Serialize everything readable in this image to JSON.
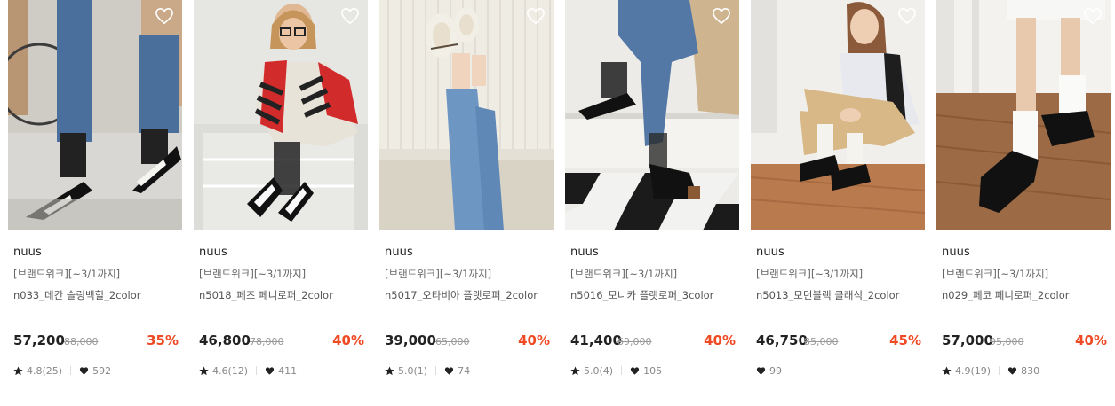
{
  "products": [
    {
      "brand": "nuus",
      "promo": "[브랜드위크][~3/1까지]",
      "name": "n033_데칸 슬링백힐_2color",
      "price": "57,200",
      "original_price": "88,000",
      "discount": "35%",
      "rating": "4.8(25)",
      "likes": "592",
      "image_description": "photo-model-with-slingback-heels"
    },
    {
      "brand": "nuus",
      "promo": "[브랜드위크][~3/1까지]",
      "name": "n5018_페즈 페니로퍼_2color",
      "price": "46,800",
      "original_price": "78,000",
      "discount": "40%",
      "rating": "4.6(12)",
      "likes": "411",
      "image_description": "photo-model-seated-in-loafers"
    },
    {
      "brand": "nuus",
      "promo": "[브랜드위크][~3/1까지]",
      "name": "n5017_오타비아 플랫로퍼_2color",
      "price": "39,000",
      "original_price": "65,000",
      "discount": "40%",
      "rating": "5.0(1)",
      "likes": "74",
      "image_description": "photo-legs-up-white-flats"
    },
    {
      "brand": "nuus",
      "promo": "[브랜드위크][~3/1까지]",
      "name": "n5016_모니카 플랫로퍼_3color",
      "price": "41,400",
      "original_price": "69,000",
      "discount": "40%",
      "rating": "5.0(4)",
      "likes": "105",
      "image_description": "photo-black-flat-loafers-on-steps"
    },
    {
      "brand": "nuus",
      "promo": "[브랜드위크][~3/1까지]",
      "name": "n5013_모던블랙 클래식_2color",
      "price": "46,750",
      "original_price": "85,000",
      "discount": "45%",
      "rating": "",
      "likes": "99",
      "image_description": "photo-model-seated-black-derby"
    },
    {
      "brand": "nuus",
      "promo": "[브랜드위크][~3/1까지]",
      "name": "n029_페코 페니로퍼_2color",
      "price": "57,000",
      "original_price": "95,000",
      "discount": "40%",
      "rating": "4.9(19)",
      "likes": "830",
      "image_description": "photo-black-penny-loafers-white-socks"
    }
  ],
  "colors": {
    "discount": "#ee4b25",
    "price": "#222222",
    "muted": "#888888"
  },
  "icons": {
    "wishlist": "heart-outline-icon",
    "rating": "star-icon",
    "likes": "heart-filled-icon"
  }
}
